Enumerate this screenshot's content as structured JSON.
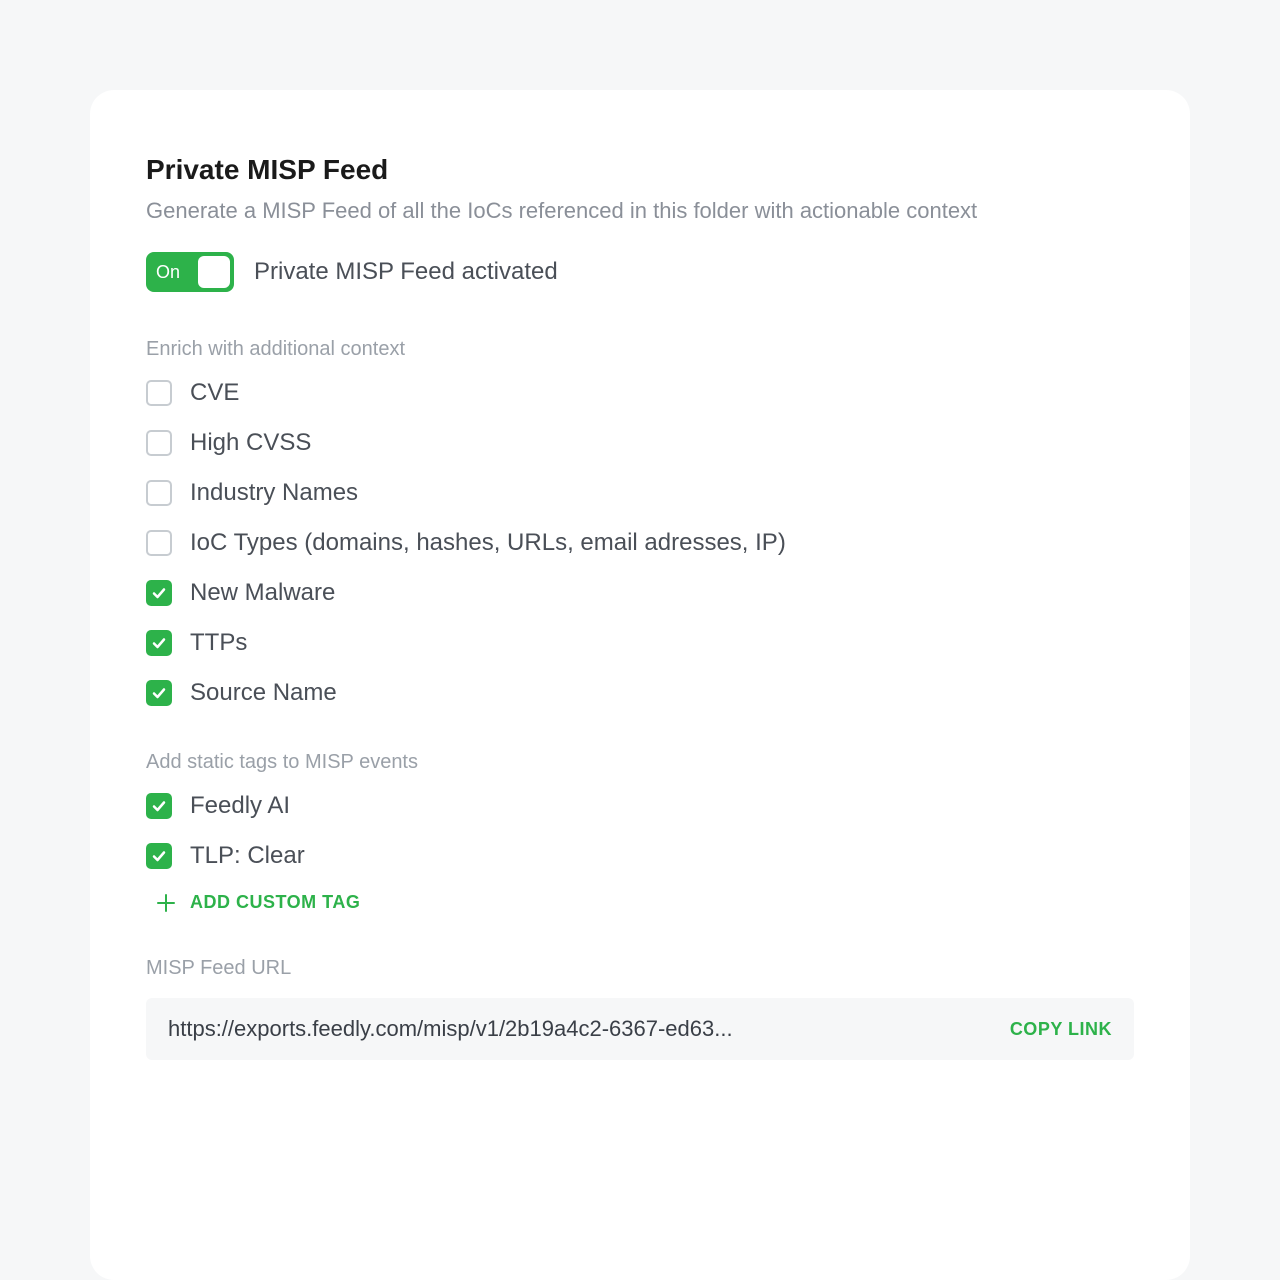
{
  "title": "Private MISP Feed",
  "subtitle": "Generate a MISP Feed of all the IoCs referenced in this folder with actionable context",
  "toggle": {
    "on_label": "On",
    "status": "Private MISP Feed activated"
  },
  "enrich": {
    "section_label": "Enrich with additional context",
    "items": [
      {
        "label": "CVE",
        "checked": false
      },
      {
        "label": "High CVSS",
        "checked": false
      },
      {
        "label": "Industry Names",
        "checked": false
      },
      {
        "label": "IoC Types (domains, hashes, URLs, email adresses, IP)",
        "checked": false
      },
      {
        "label": "New Malware",
        "checked": true
      },
      {
        "label": "TTPs",
        "checked": true
      },
      {
        "label": "Source  Name",
        "checked": true
      }
    ]
  },
  "tags": {
    "section_label": "Add static tags to MISP events",
    "items": [
      {
        "label": "Feedly AI",
        "checked": true
      },
      {
        "label": "TLP: Clear",
        "checked": true
      }
    ],
    "add_label": "ADD CUSTOM TAG"
  },
  "url": {
    "section_label": "MISP Feed URL",
    "value": "https://exports.feedly.com/misp/v1/2b19a4c2-6367-ed63...",
    "copy_label": "COPY LINK"
  }
}
